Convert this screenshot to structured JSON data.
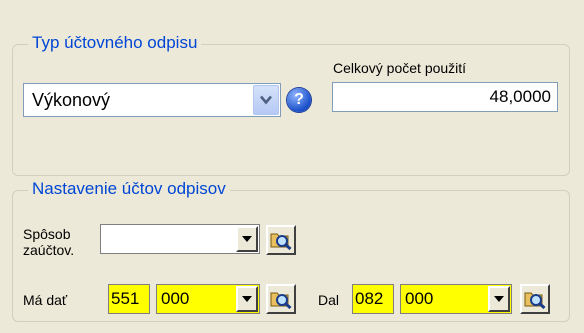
{
  "section_type": {
    "title": "Typ účtovného odpisu",
    "type_value": "Výkonový",
    "help_glyph": "?",
    "total_label": "Celkový počet použití",
    "total_value": "48,0000"
  },
  "section_accounts": {
    "title": "Nastavenie účtov odpisov",
    "method_label_line1": "Spôsob",
    "method_label_line2": "zaúčtov.",
    "method_value": "",
    "debit_label": "Má dať",
    "debit_account": "551",
    "debit_analytic": "000",
    "credit_label": "Dal",
    "credit_account": "082",
    "credit_analytic": "000"
  },
  "icons": {
    "dropdown": "chevron-down-icon",
    "help": "help-icon",
    "lookup": "search-folder-icon"
  },
  "colors": {
    "window_bg": "#ece9d8",
    "legend_text": "#0046d5",
    "highlight_field": "#ffff00"
  }
}
